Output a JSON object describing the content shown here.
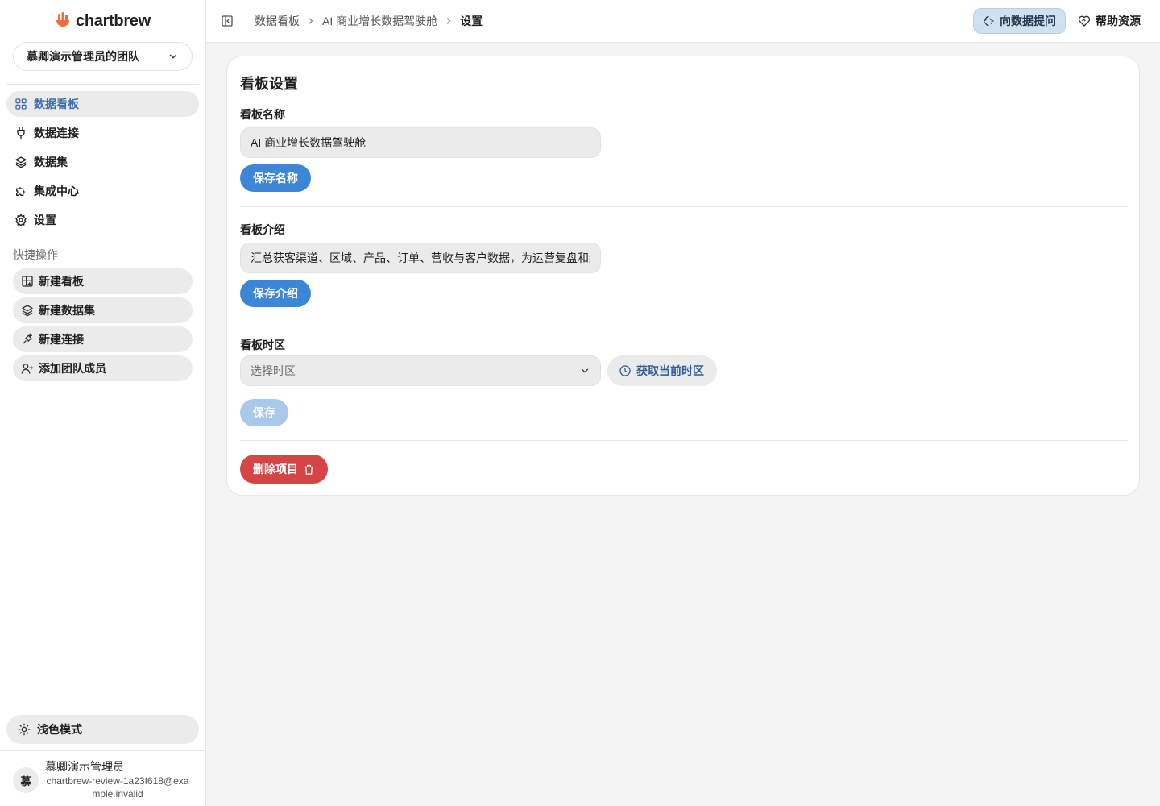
{
  "app": {
    "logo_text": "chartbrew"
  },
  "sidebar": {
    "team_name": "慕卿演示管理员的团队",
    "nav": [
      {
        "label": "数据看板",
        "icon": "dashboard-grid-icon",
        "active": true
      },
      {
        "label": "数据连接",
        "icon": "plug-icon",
        "active": false
      },
      {
        "label": "数据集",
        "icon": "layers-icon",
        "active": false
      },
      {
        "label": "集成中心",
        "icon": "puzzle-icon",
        "active": false
      },
      {
        "label": "设置",
        "icon": "gear-icon",
        "active": false
      }
    ],
    "quick_actions_label": "快捷操作",
    "quick_actions": [
      {
        "label": "新建看板",
        "icon": "grid-plus-icon"
      },
      {
        "label": "新建数据集",
        "icon": "layers-plus-icon"
      },
      {
        "label": "新建连接",
        "icon": "plug-plus-icon"
      },
      {
        "label": "添加团队成员",
        "icon": "user-plus-icon"
      }
    ],
    "theme_label": "浅色模式",
    "user": {
      "avatar_initial": "慕",
      "name": "慕卿演示管理员",
      "email": "chartbrew-review-1a23f618@example.invalid"
    }
  },
  "topbar": {
    "breadcrumb": [
      "数据看板",
      "AI 商业增长数据驾驶舱",
      "设置"
    ],
    "ask_label": "向数据提问",
    "help_label": "帮助资源"
  },
  "settings": {
    "title": "看板设置",
    "name_label": "看板名称",
    "name_value": "AI 商业增长数据驾驶舱",
    "save_name_label": "保存名称",
    "description_label": "看板介绍",
    "description_value": "汇总获客渠道、区域、产品、订单、营收与客户数据，为运营复盘和经",
    "save_description_label": "保存介绍",
    "timezone_label": "看板时区",
    "timezone_placeholder": "选择时区",
    "get_timezone_label": "获取当前时区",
    "save_label": "保存",
    "delete_label": "删除项目"
  },
  "colors": {
    "primary": "#3b86d6",
    "primary_disabled": "#a9c9eb",
    "danger": "#d64545",
    "active_nav_text": "#3f6fa8",
    "brand_orange": "#f26b3a"
  }
}
